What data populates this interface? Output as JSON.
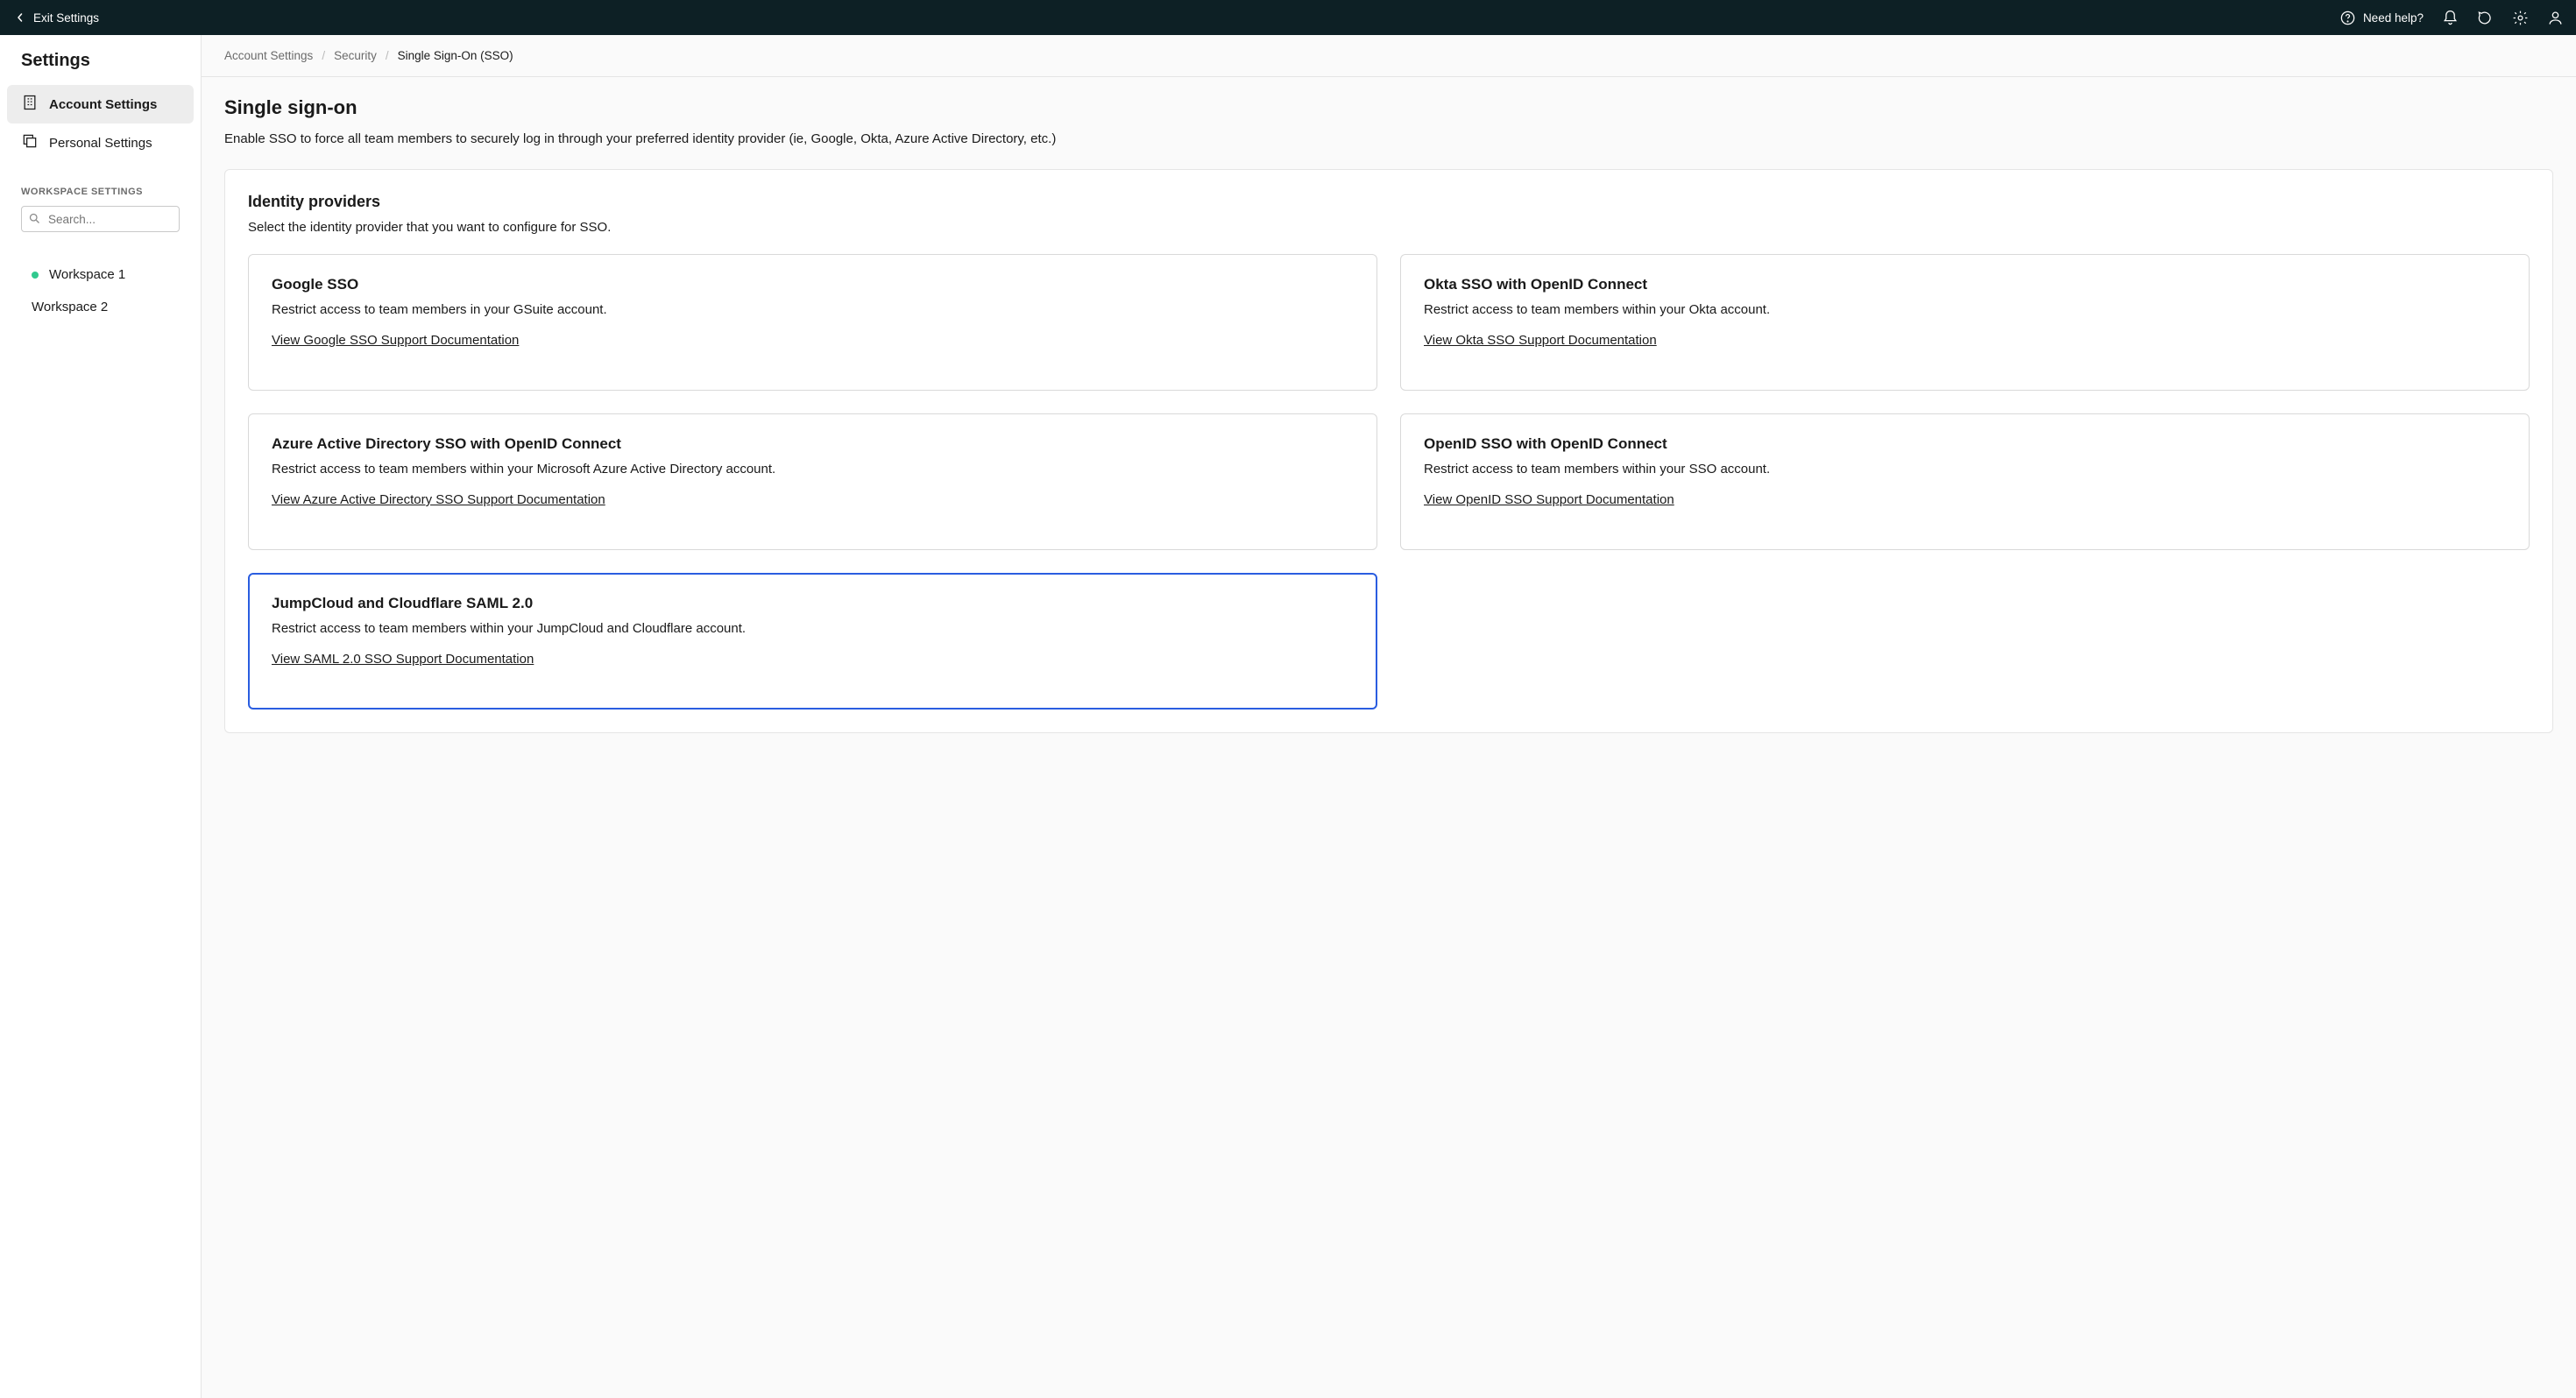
{
  "topbar": {
    "exit_label": "Exit Settings",
    "need_help_label": "Need help?"
  },
  "sidebar": {
    "title": "Settings",
    "nav": {
      "account_label": "Account Settings",
      "personal_label": "Personal Settings"
    },
    "workspace_section_label": "WORKSPACE SETTINGS",
    "search_placeholder": "Search...",
    "workspaces": [
      {
        "name": "Workspace 1",
        "active": true
      },
      {
        "name": "Workspace 2",
        "active": false
      }
    ]
  },
  "breadcrumb": {
    "items": [
      "Account Settings",
      "Security",
      "Single Sign-On (SSO)"
    ]
  },
  "page": {
    "title": "Single sign-on",
    "description": "Enable SSO to force all team members to securely log in through your preferred identity provider (ie, Google, Okta, Azure Active Directory, etc.)"
  },
  "identity_card": {
    "title": "Identity providers",
    "subtitle": "Select the identity provider that you want to configure for SSO.",
    "providers": [
      {
        "name": "Google SSO",
        "desc": "Restrict access to team members in your GSuite account.",
        "link": "View Google SSO Support Documentation",
        "selected": false
      },
      {
        "name": "Okta SSO with OpenID Connect",
        "desc": "Restrict access to team members within your Okta account.",
        "link": "View Okta SSO Support Documentation",
        "selected": false
      },
      {
        "name": "Azure Active Directory SSO with OpenID Connect",
        "desc": "Restrict access to team members within your Microsoft Azure Active Directory account.",
        "link": "View Azure Active Directory SSO Support Documentation",
        "selected": false
      },
      {
        "name": "OpenID SSO with OpenID Connect",
        "desc": "Restrict access to team members within your SSO account.",
        "link": "View OpenID SSO Support Documentation",
        "selected": false
      },
      {
        "name": "JumpCloud and Cloudflare SAML 2.0",
        "desc": "Restrict access to team members within your JumpCloud and Cloudflare account.",
        "link": "View SAML 2.0 SSO Support Documentation",
        "selected": true
      }
    ]
  }
}
